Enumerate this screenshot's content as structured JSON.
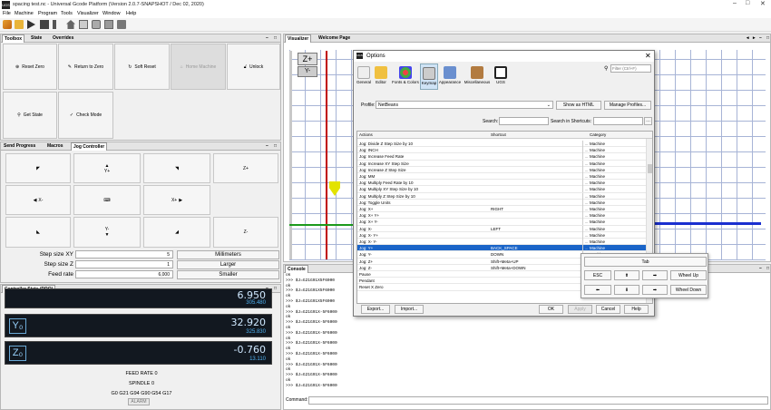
{
  "window": {
    "title": "spacing test.nc - Universal Gcode Platform (Version 2.0.7-SNAPSHOT / Dec 02, 2020)",
    "app_icon_text": "UGS"
  },
  "menu": [
    "File",
    "Machine",
    "Program",
    "Tools",
    "Visualizer",
    "Window",
    "Help"
  ],
  "left_tabs": [
    "Toolbox",
    "State",
    "Overrides"
  ],
  "toolbox": {
    "reset_zero": "Reset Zero",
    "return_to_zero": "Return to Zero",
    "soft_reset": "Soft Reset",
    "home_machine": "Home Machine",
    "unlock": "Unlock",
    "get_state": "Get State",
    "check_mode": "Check Mode"
  },
  "jog_tabs": [
    "Send Progress",
    "Macros",
    "Jog Controller"
  ],
  "jog": {
    "y_plus": "Y+",
    "z_plus": "Z+",
    "x_minus": "X-",
    "x_plus": "X+",
    "y_minus": "Y-",
    "z_minus": "Z-",
    "step_xy_label": "Step size XY",
    "step_xy_value": "5",
    "step_z_label": "Step size Z",
    "step_z_value": "1",
    "feed_label": "Feed rate",
    "feed_value": "6,000",
    "units_btn": "Millimeters",
    "larger_btn": "Larger",
    "smaller_btn": "Smaller"
  },
  "dro": {
    "tab": "Controller State (DRO)",
    "x_label": "X₀",
    "x_value": "6.950",
    "x_sub": "305.480",
    "y_label": "Y₀",
    "y_value": "32.920",
    "y_sub": "325.830",
    "z_label": "Z₀",
    "z_value": "-0.760",
    "z_sub": "13.110",
    "feed_rate": "FEED RATE 0",
    "spindle": "SPINDLE 0",
    "gcodes": "G0 G21 G94 G90 G54 G17",
    "alarm": "ALARM"
  },
  "right_tabs": [
    "Visualizer",
    "Welcome Page"
  ],
  "visualizer": {
    "zplus": "Z+",
    "yminus": "Y-"
  },
  "console": {
    "tab": "Console",
    "lines": [
      "ok",
      ">>> $J=G21G91X5F6000",
      "ok",
      ">>> $J=G21G91X5F6000",
      "ok",
      ">>> $J=G21G91X5F6000",
      "ok",
      ">>> $J=G21G91X-5F6000",
      "ok",
      ">>> $J=G21G91X-5F6000",
      "ok",
      ">>> $J=G21G91X-5F6000",
      "ok",
      ">>> $J=G21G91X-5F6000",
      "ok",
      ">>> $J=G21G91X-5F6000",
      "ok",
      ">>> $J=G21G91X-5F6000",
      "ok",
      ">>> $J=G21G91X-5F6000",
      "ok",
      ">>> $J=G21G91X-5F6000"
    ],
    "command_label": "Command:"
  },
  "dialog": {
    "title": "Options",
    "filter_placeholder": "Filter (Ctrl+F)",
    "categories": [
      "General",
      "Editor",
      "Fonts & Colors",
      "Keymap",
      "Appearance",
      "Miscellaneous",
      "UGS"
    ],
    "profile_label": "Profile:",
    "profile_value": "NetBeans",
    "show_html": "Show as HTML",
    "manage_profiles": "Manage Profiles...",
    "search_label": "Search:",
    "search_shortcuts_label": "Search in Shortcuts:",
    "col_actions": "Actions",
    "col_shortcut": "Shortcut",
    "col_category": "Category",
    "rows": [
      {
        "a": "Jog: Divide Z Step Size by 10",
        "s": "",
        "c": "Machine"
      },
      {
        "a": "Jog: INCH",
        "s": "",
        "c": "Machine"
      },
      {
        "a": "Jog: Increase Feed Rate",
        "s": "",
        "c": "Machine"
      },
      {
        "a": "Jog: Increase XY Step Size",
        "s": "",
        "c": "Machine"
      },
      {
        "a": "Jog: Increase Z Step Size",
        "s": "",
        "c": "Machine"
      },
      {
        "a": "Jog: MM",
        "s": "",
        "c": "Machine"
      },
      {
        "a": "Jog: Multiply Feed Rate by 10",
        "s": "",
        "c": "Machine"
      },
      {
        "a": "Jog: Multiply XY Step Size by 10",
        "s": "",
        "c": "Machine"
      },
      {
        "a": "Jog: Multiply Z Step Size by 10",
        "s": "",
        "c": "Machine"
      },
      {
        "a": "Jog: Toggle Units",
        "s": "",
        "c": "Machine"
      },
      {
        "a": "Jog: X+",
        "s": "RIGHT",
        "c": "Machine"
      },
      {
        "a": "Jog: X+ Y+",
        "s": "",
        "c": "Machine"
      },
      {
        "a": "Jog: X+ Y-",
        "s": "",
        "c": "Machine"
      },
      {
        "a": "Jog: X-",
        "s": "LEFT",
        "c": "Machine"
      },
      {
        "a": "Jog: X- Y+",
        "s": "",
        "c": "Machine"
      },
      {
        "a": "Jog: X- Y-",
        "s": "",
        "c": "Machine"
      },
      {
        "a": "Jog: Y+",
        "s": "BACK_SPACE",
        "c": "Machine"
      },
      {
        "a": "Jog: Y-",
        "s": "DOWN",
        "c": "Machine"
      },
      {
        "a": "Jog: Z+",
        "s": "Shift+Meta+UP",
        "c": "Machine"
      },
      {
        "a": "Jog: Z-",
        "s": "Shift+Meta+DOWN",
        "c": "Machine"
      },
      {
        "a": "Pause",
        "s": "",
        "c": ""
      },
      {
        "a": "Pendant",
        "s": "",
        "c": ""
      },
      {
        "a": "Reset X Zero",
        "s": "",
        "c": ""
      }
    ],
    "export_btn": "Export...",
    "import_btn": "Import...",
    "ok_btn": "OK",
    "apply_btn": "Apply",
    "cancel_btn": "Cancel",
    "help_btn": "Help"
  },
  "key_popup": {
    "tab": "Tab",
    "esc": "ESC",
    "wheel_up": "Wheel Up",
    "wheel_down": "Wheel Down"
  }
}
